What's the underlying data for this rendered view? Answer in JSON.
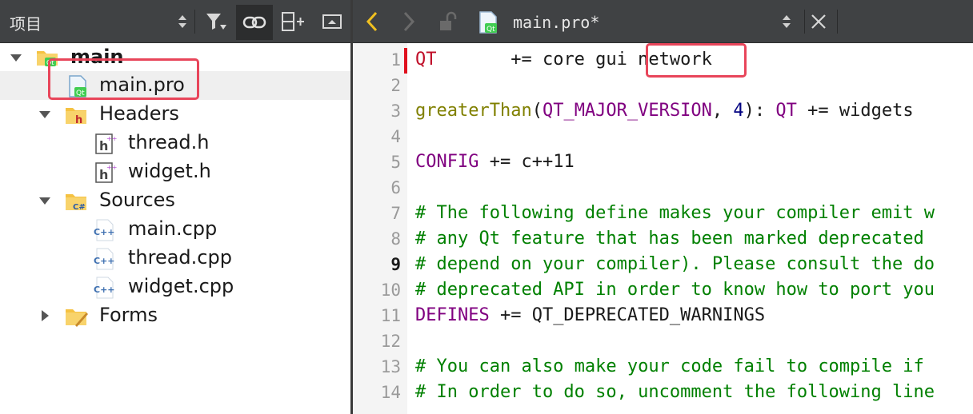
{
  "left_panel": {
    "title": "项目",
    "tree": [
      {
        "label": "main",
        "icon": "qt-project-folder-icon",
        "expanded": true
      },
      {
        "label": "main.pro",
        "icon": "qt-pro-file-icon",
        "selected": true
      },
      {
        "label": "Headers",
        "icon": "headers-folder-icon",
        "expanded": true
      },
      {
        "label": "thread.h",
        "icon": "header-file-icon"
      },
      {
        "label": "widget.h",
        "icon": "header-file-icon"
      },
      {
        "label": "Sources",
        "icon": "sources-folder-icon",
        "expanded": true
      },
      {
        "label": "main.cpp",
        "icon": "cpp-file-icon"
      },
      {
        "label": "thread.cpp",
        "icon": "cpp-file-icon"
      },
      {
        "label": "widget.cpp",
        "icon": "cpp-file-icon"
      },
      {
        "label": "Forms",
        "icon": "forms-folder-icon",
        "expanded": false
      }
    ]
  },
  "editor": {
    "file_name": "main.pro*",
    "current_line": 9,
    "lines": [
      {
        "n": "1",
        "tokens": [
          {
            "t": "QT",
            "c": "tk-red"
          },
          {
            "t": "       += core gui ",
            "c": "tk-plain"
          },
          {
            "t": "network",
            "c": "tk-plain"
          }
        ]
      },
      {
        "n": "2",
        "tokens": []
      },
      {
        "n": "3",
        "tokens": [
          {
            "t": "greaterThan",
            "c": "tk-fn"
          },
          {
            "t": "(",
            "c": "tk-plain"
          },
          {
            "t": "QT_MAJOR_VERSION",
            "c": "tk-var"
          },
          {
            "t": ", ",
            "c": "tk-plain"
          },
          {
            "t": "4",
            "c": "tk-num"
          },
          {
            "t": "): ",
            "c": "tk-plain"
          },
          {
            "t": "QT",
            "c": "tk-var"
          },
          {
            "t": " += widgets",
            "c": "tk-plain"
          }
        ]
      },
      {
        "n": "4",
        "tokens": []
      },
      {
        "n": "5",
        "tokens": [
          {
            "t": "CONFIG",
            "c": "tk-var"
          },
          {
            "t": " += c++11",
            "c": "tk-plain"
          }
        ]
      },
      {
        "n": "6",
        "tokens": []
      },
      {
        "n": "7",
        "tokens": [
          {
            "t": "# The following define makes your compiler emit w",
            "c": "tk-comment"
          }
        ]
      },
      {
        "n": "8",
        "tokens": [
          {
            "t": "# any Qt feature that has been marked deprecated",
            "c": "tk-comment"
          }
        ]
      },
      {
        "n": "9",
        "tokens": [
          {
            "t": "# depend on your compiler). Please consult the do",
            "c": "tk-comment"
          }
        ]
      },
      {
        "n": "10",
        "tokens": [
          {
            "t": "# deprecated API in order to know how to port you",
            "c": "tk-comment"
          }
        ]
      },
      {
        "n": "11",
        "tokens": [
          {
            "t": "DEFINES",
            "c": "tk-var"
          },
          {
            "t": " += QT_DEPRECATED_WARNINGS",
            "c": "tk-plain"
          }
        ]
      },
      {
        "n": "12",
        "tokens": []
      },
      {
        "n": "13",
        "tokens": [
          {
            "t": "# You can also make your code fail to compile if",
            "c": "tk-comment"
          }
        ]
      },
      {
        "n": "14",
        "tokens": [
          {
            "t": "# In order to do so, uncomment the following line",
            "c": "tk-comment"
          }
        ]
      }
    ]
  },
  "colors": {
    "toolbar": "#404244",
    "highlight": "#e8455a",
    "comment": "#008000",
    "keyword_var": "#800080",
    "function": "#808000"
  }
}
